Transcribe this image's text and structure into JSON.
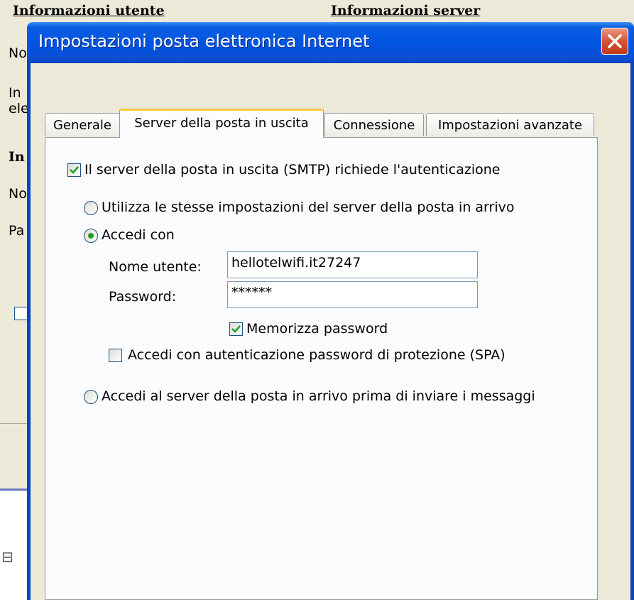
{
  "background": {
    "header_user_info": "Informazioni utente",
    "header_server_info": "Informazioni server",
    "fragment_no1": "No",
    "fragment_in": "In",
    "fragment_ele": "ele",
    "fragment_in_bold": "In",
    "fragment_no2": "No",
    "fragment_pa": "Pa"
  },
  "dialog": {
    "title": "Impostazioni posta elettronica Internet",
    "tabs": [
      {
        "label": "Generale",
        "active": false
      },
      {
        "label": "Server della posta in uscita",
        "active": true
      },
      {
        "label": "Connessione",
        "active": false
      },
      {
        "label": "Impostazioni avanzate",
        "active": false
      }
    ],
    "smtp_auth": {
      "label": "Il server della posta in uscita (SMTP) richiede l'autenticazione",
      "checked": true
    },
    "radio_same_settings": {
      "label": "Utilizza le stesse impostazioni del server della posta in arrivo",
      "selected": false
    },
    "radio_login_with": {
      "label": "Accedi con",
      "selected": true
    },
    "username": {
      "label": "Nome utente:",
      "value": "hellotelwifi.it27247"
    },
    "password": {
      "label": "Password:",
      "value": "******"
    },
    "remember_password": {
      "label": "Memorizza password",
      "checked": true
    },
    "spa": {
      "label": "Accedi con autenticazione password di protezione (SPA)",
      "checked": false
    },
    "radio_incoming_first": {
      "label": "Accedi al server della posta in arrivo prima di inviare i messaggi",
      "selected": false
    }
  },
  "colors": {
    "title_bar": "#0054e3",
    "active_tab_highlight": "#ffc83c",
    "check_green": "#21a121",
    "close_button": "#d45334"
  }
}
